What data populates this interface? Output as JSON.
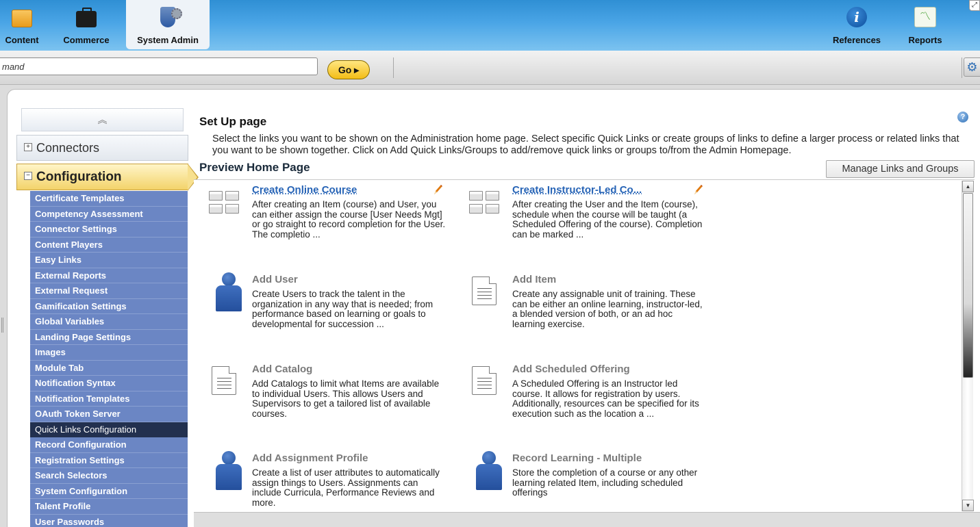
{
  "topnav": {
    "left_tabs": [
      {
        "label": "Content",
        "icon": "folder-icon"
      },
      {
        "label": "Commerce",
        "icon": "briefcase-icon"
      },
      {
        "label": "System Admin",
        "icon": "admin-user-icon",
        "active": true
      }
    ],
    "right_tabs": [
      {
        "label": "References",
        "icon": "info-icon"
      },
      {
        "label": "Reports",
        "icon": "chart-icon"
      }
    ]
  },
  "command": {
    "input_value": "mand",
    "go_label": "Go ▸"
  },
  "sidebar": {
    "connectors_label": "Connectors",
    "configuration_label": "Configuration",
    "items": [
      "Certificate Templates",
      "Competency Assessment",
      "Connector Settings",
      "Content Players",
      "Easy Links",
      "External Reports",
      "External Request",
      "Gamification Settings",
      "Global Variables",
      "Landing Page Settings",
      "Images",
      "Module Tab",
      "Notification Syntax",
      "Notification Templates",
      "OAuth Token Server",
      "Quick Links Configuration",
      "Record Configuration",
      "Registration Settings",
      "Search Selectors",
      "System Configuration",
      "Talent Profile",
      "User Passwords"
    ],
    "selected": "Quick Links Configuration"
  },
  "main": {
    "setup_title": "Set Up page",
    "setup_desc": "Select the links you want to be shown on the Administration home page.  Select specific Quick Links or create groups of links to define a larger process or related links that you want to be shown together. Click on Add Quick Links/Groups to add/remove quick links or groups to/from the Admin Homepage.",
    "preview_title": "Preview Home Page",
    "manage_button": "Manage Links and Groups",
    "cards": [
      {
        "title": "Create Online Course",
        "desc": "After creating an Item (course) and User, you can either assign the course [User Needs Mgt] or go straight to record completion for the User.  The completio ...",
        "icon": "grid-icon",
        "editable": true,
        "link": true
      },
      {
        "title": "Create Instructor-Led Co...",
        "desc": "After creating the User and the Item (course), schedule when the course will be taught (a Scheduled Offering of the course).  Completion can be marked ...",
        "icon": "grid-icon",
        "editable": true,
        "link": true
      },
      {
        "title": "Add User",
        "desc": "Create Users to track the talent in the organization in any way that is needed; from performance based on learning or goals to developmental for succession ...",
        "icon": "person-icon"
      },
      {
        "title": "Add Item",
        "desc": "Create any assignable unit of training.  These can be either an online learning, instructor-led, a blended version of both, or an ad hoc learning exercise.",
        "icon": "document-icon"
      },
      {
        "title": "Add Catalog",
        "desc": "Add Catalogs to limit what Items are available to individual Users.  This allows Users and Supervisors to get a tailored list of available courses.",
        "icon": "document-icon"
      },
      {
        "title": "Add Scheduled Offering",
        "desc": "A Scheduled Offering is an Instructor led course.  It allows for registration by users.  Additionally, resources can be specified for its execution such as the location a ...",
        "icon": "document-icon"
      },
      {
        "title": "Add Assignment Profile",
        "desc": "Create a list of user attributes to automatically assign things to Users.  Assignments can include Curricula, Performance Reviews and more.",
        "icon": "person-icon"
      },
      {
        "title": "Record Learning - Multiple",
        "desc": "Store the completion of a course or any other learning related Item, including scheduled offerings",
        "icon": "person-icon"
      }
    ]
  }
}
